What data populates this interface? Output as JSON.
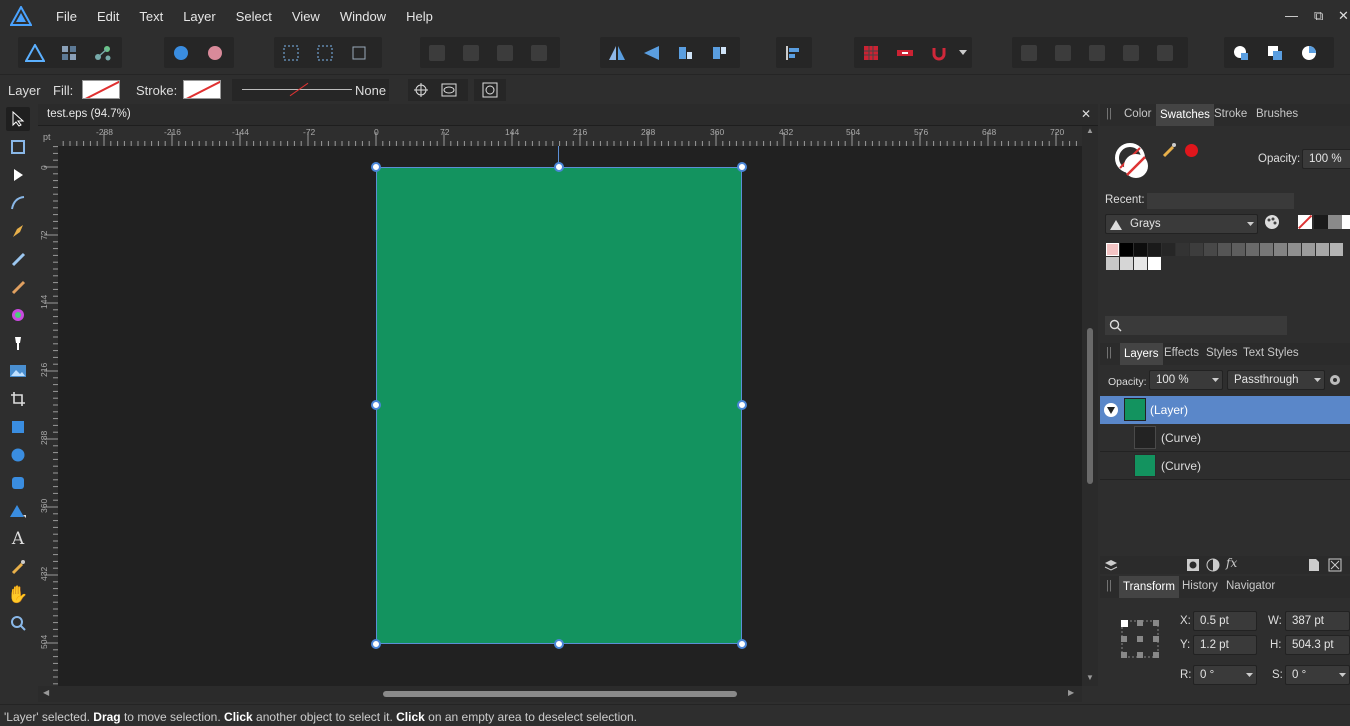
{
  "menu": [
    "File",
    "Edit",
    "Text",
    "Layer",
    "Select",
    "View",
    "Window",
    "Help"
  ],
  "window_controls": {
    "minimize": "—",
    "restore": "⧉",
    "close": "✕"
  },
  "context_bar": {
    "selection_label": "Layer",
    "fill_label": "Fill:",
    "stroke_label": "Stroke:",
    "stroke_style": "None"
  },
  "document": {
    "tab_title": "test.eps (94.7%)",
    "close": "✕",
    "ruler_unit": "pt",
    "ruler_h_ticks": [
      "-288",
      "-216",
      "-144",
      "-72",
      "0",
      "72",
      "144",
      "216",
      "288",
      "360",
      "432",
      "504",
      "576",
      "648",
      "720"
    ],
    "ruler_v_ticks": [
      "0",
      "72",
      "144",
      "216",
      "288",
      "360",
      "432",
      "504"
    ],
    "shape_color": "#13935f"
  },
  "color_panel": {
    "tabs": [
      "Color",
      "Swatches",
      "Stroke",
      "Brushes"
    ],
    "active_tab": "Swatches",
    "opacity_label": "Opacity:",
    "opacity_value": "100 %",
    "recent_label": "Recent:",
    "palette_name": "Grays"
  },
  "layers_panel": {
    "tabs": [
      "Layers",
      "Effects",
      "Styles",
      "Text Styles"
    ],
    "active_tab": "Layers",
    "opacity_label": "Opacity:",
    "opacity_value": "100 %",
    "blend_mode": "Passthrough",
    "rows": [
      {
        "name": "(Layer)",
        "selected": true
      },
      {
        "name": "(Curve)",
        "selected": false
      },
      {
        "name": "(Curve)",
        "selected": false
      }
    ]
  },
  "transform_panel": {
    "tabs": [
      "Transform",
      "History",
      "Navigator"
    ],
    "active_tab": "Transform",
    "x_label": "X:",
    "x_value": "0.5 pt",
    "y_label": "Y:",
    "y_value": "1.2 pt",
    "w_label": "W:",
    "w_value": "387 pt",
    "h_label": "H:",
    "h_value": "504.3 pt",
    "r_label": "R:",
    "r_value": "0 °",
    "s_label": "S:",
    "s_value": "0 °"
  },
  "status": {
    "part1": "'Layer' selected. ",
    "bold1": "Drag",
    "part2": " to move selection. ",
    "bold2": "Click",
    "part3": " another object to select it. ",
    "bold3": "Click",
    "part4": " on an empty area to deselect selection."
  },
  "accent_color": "#5b8fd6"
}
